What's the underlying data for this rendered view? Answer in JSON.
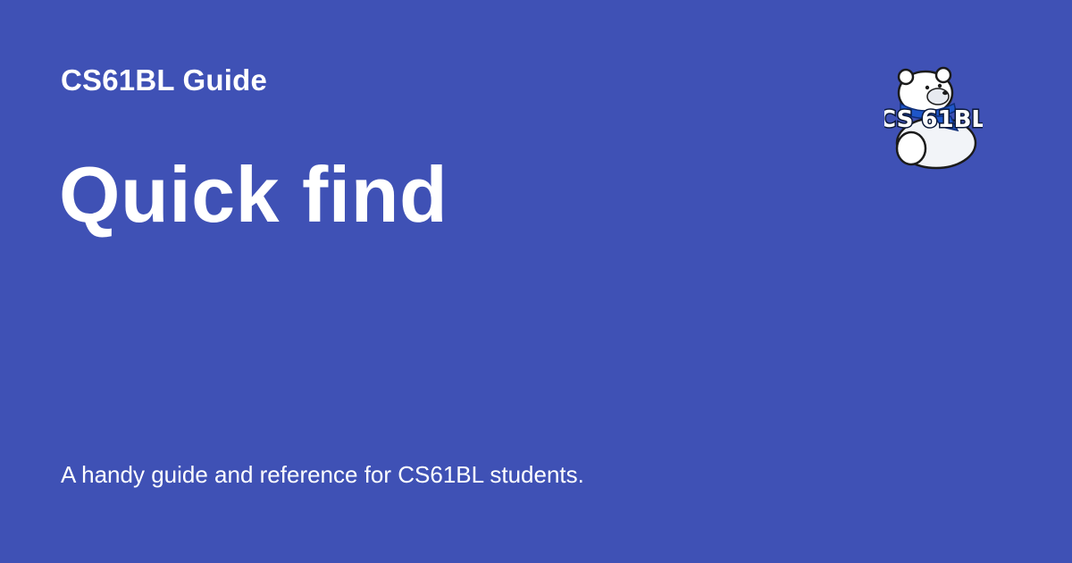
{
  "site": {
    "name": "CS61BL Guide"
  },
  "page": {
    "title": "Quick find",
    "description": "A handy guide and reference for CS61BL students."
  },
  "logo": {
    "icon": "polar-bear-mascot-icon",
    "text": "CS 61BL",
    "scarf_color": "#1e56c8"
  },
  "colors": {
    "background": "#3f51b5",
    "text": "#ffffff"
  }
}
